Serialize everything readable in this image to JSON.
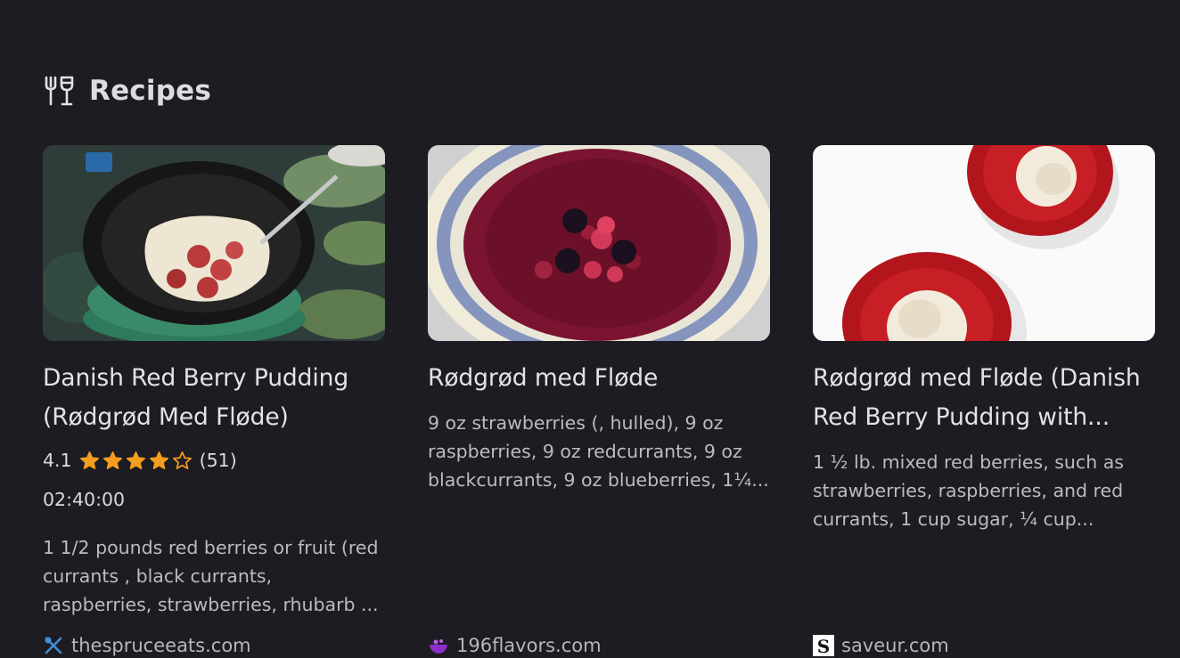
{
  "section": {
    "title": "Recipes",
    "icon": "utensils-glass-icon"
  },
  "cards": [
    {
      "title": "Danish Red Berry Pudding (Rødgrød Med Fløde)",
      "rating": "4.1",
      "rating_value": 4.1,
      "review_count": "(51)",
      "time": "02:40:00",
      "description": "1 1/2 pounds red berries or fruit (red currants , black currants, raspberries, strawberries, rhubarb ...",
      "source": "thespruceeats.com",
      "source_icon": "spruce-utensils-icon"
    },
    {
      "title": "Rødgrød med Fløde",
      "description": "9 oz strawberries (, hulled), 9 oz raspberries, 9 oz redcurrants, 9 oz blackcurrants, 9 oz blueberries, 1¼...",
      "source": "196flavors.com",
      "source_icon": "bowl-icon"
    },
    {
      "title": "Rødgrød med Fløde (Danish Red Berry Pudding with...",
      "description": "1 ½ lb. mixed red berries, such as strawberries, raspberries, and red currants, 1 cup sugar, ¼ cup...",
      "source": "saveur.com",
      "source_icon": "saveur-s-icon"
    }
  ],
  "colors": {
    "background": "#1d1c22",
    "star": "#f59d1e",
    "text": "#e4e1e8"
  }
}
